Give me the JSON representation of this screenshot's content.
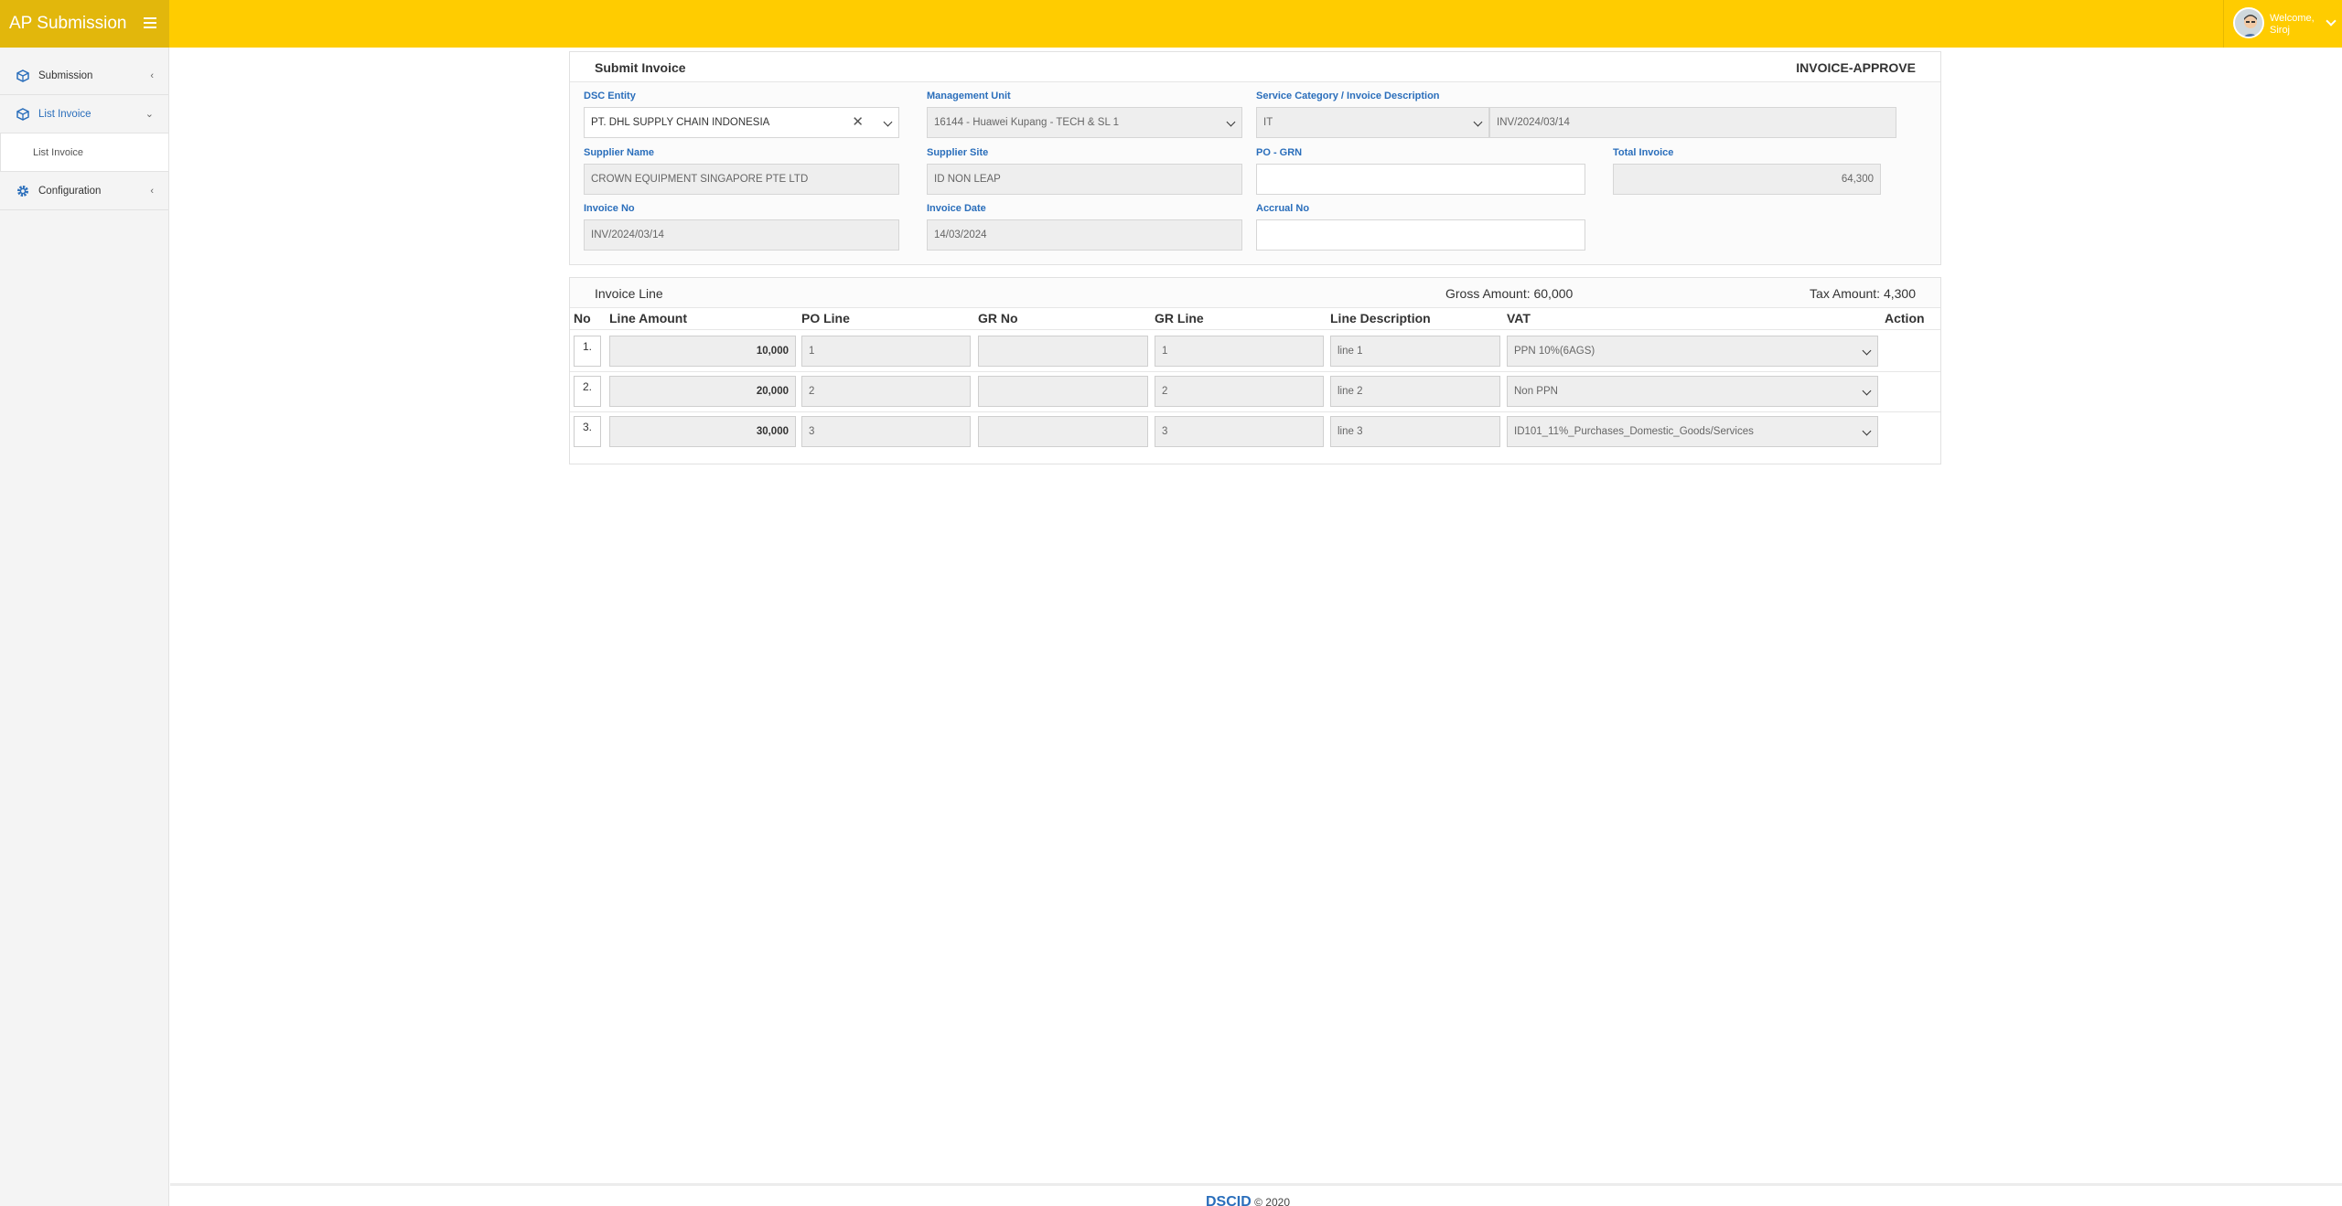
{
  "app": {
    "title": "AP Submission"
  },
  "user": {
    "welcome": "Welcome,",
    "name": "Siroj"
  },
  "sidebar": {
    "items": [
      {
        "label": "Submission",
        "arrow": "‹"
      },
      {
        "label": "List Invoice",
        "arrow": "⌄"
      },
      {
        "label": "Configuration",
        "arrow": "‹"
      }
    ],
    "sub_items": [
      {
        "label": "List Invoice"
      }
    ]
  },
  "form": {
    "title": "Submit Invoice",
    "status": "INVOICE-APPROVE",
    "dsc_entity": {
      "label": "DSC Entity",
      "value": "PT. DHL SUPPLY CHAIN INDONESIA"
    },
    "management_unit": {
      "label": "Management Unit",
      "value": "16144 - Huawei Kupang - TECH & SL 1"
    },
    "service_category": {
      "label": "Service Category / Invoice Description",
      "value": "IT",
      "description": "INV/2024/03/14"
    },
    "supplier_name": {
      "label": "Supplier Name",
      "value": "CROWN EQUIPMENT SINGAPORE PTE LTD"
    },
    "supplier_site": {
      "label": "Supplier Site",
      "value": "ID NON LEAP"
    },
    "po_grn": {
      "label": "PO - GRN",
      "value": ""
    },
    "total_invoice": {
      "label": "Total Invoice",
      "value": "64,300"
    },
    "invoice_no": {
      "label": "Invoice No",
      "value": "INV/2024/03/14"
    },
    "invoice_date": {
      "label": "Invoice Date",
      "value": "14/03/2024"
    },
    "accrual_no": {
      "label": "Accrual No",
      "value": ""
    }
  },
  "invoice_line": {
    "title": "Invoice Line",
    "gross": "Gross Amount: 60,000",
    "tax": "Tax Amount: 4,300",
    "headers": {
      "no": "No",
      "line_amount": "Line Amount",
      "po_line": "PO Line",
      "gr_no": "GR No",
      "gr_line": "GR Line",
      "line_desc": "Line Description",
      "vat": "VAT",
      "action": "Action"
    },
    "rows": [
      {
        "no": "1.",
        "amount": "10,000",
        "po_line": "1",
        "gr_no": "",
        "gr_line": "1",
        "desc": "line 1",
        "vat": "PPN 10%(6AGS)"
      },
      {
        "no": "2.",
        "amount": "20,000",
        "po_line": "2",
        "gr_no": "",
        "gr_line": "2",
        "desc": "line 2",
        "vat": "Non PPN"
      },
      {
        "no": "3.",
        "amount": "30,000",
        "po_line": "3",
        "gr_no": "",
        "gr_line": "3",
        "desc": "line 3",
        "vat": "ID101_11%_Purchases_Domestic_Goods/Services"
      }
    ]
  },
  "footer": {
    "brand": "DSCID",
    "copy": " © 2020"
  }
}
